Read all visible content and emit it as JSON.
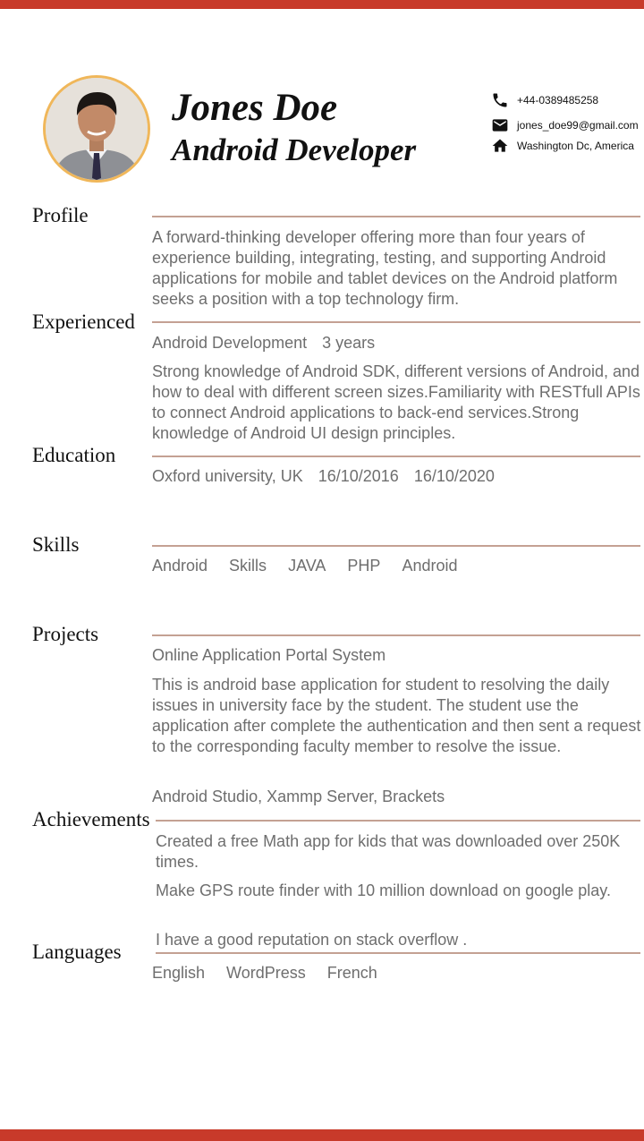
{
  "header": {
    "name": "Jones Doe",
    "title": "Android Developer",
    "contact": {
      "phone": "+44-0389485258",
      "email": "jones_doe99@gmail.com",
      "address": "Washington Dc, America"
    }
  },
  "sections": {
    "profile": {
      "title": "Profile",
      "text": "A forward-thinking developer offering more than four years of experience building, integrating, testing, and supporting Android applications for mobile and tablet devices on the Android platform seeks a position with a top technology firm."
    },
    "experienced": {
      "title": "Experienced",
      "role": "Android Development",
      "duration": "3 years",
      "description": "Strong knowledge of Android SDK, different versions of Android, and how to deal with different screen sizes.Familiarity with RESTfull APIs to connect Android applications to back-end services.Strong knowledge of Android UI design principles."
    },
    "education": {
      "title": "Education",
      "school": "Oxford university, UK",
      "start": "16/10/2016",
      "end": "16/10/2020"
    },
    "skills": {
      "title": "Skills",
      "items": [
        "Android",
        "Skills",
        "JAVA",
        "PHP",
        "Android"
      ]
    },
    "projects": {
      "title": "Projects",
      "name": "Online Application Portal System",
      "description": "This is android base application for student to resolving the daily issues in university face by the student. The student use the application after complete the authentication and then sent a request to the corresponding faculty member to resolve the issue.",
      "tools": "Android Studio, Xammp Server, Brackets"
    },
    "achievements": {
      "title": "Achievements",
      "items": [
        "Created a free Math app for kids that was downloaded over 250K times.",
        "Make GPS route finder with 10 million download on google play.",
        "I have a good reputation on stack overflow ."
      ]
    },
    "languages": {
      "title": "Languages",
      "items": [
        "English",
        "WordPress",
        "French"
      ]
    }
  },
  "colors": {
    "accent_bar": "#c83a2a",
    "avatar_ring": "#f0b75a",
    "divider": "#c4a193",
    "body_text": "#6e6e6e"
  },
  "icons": [
    "phone-icon",
    "email-icon",
    "home-icon"
  ]
}
